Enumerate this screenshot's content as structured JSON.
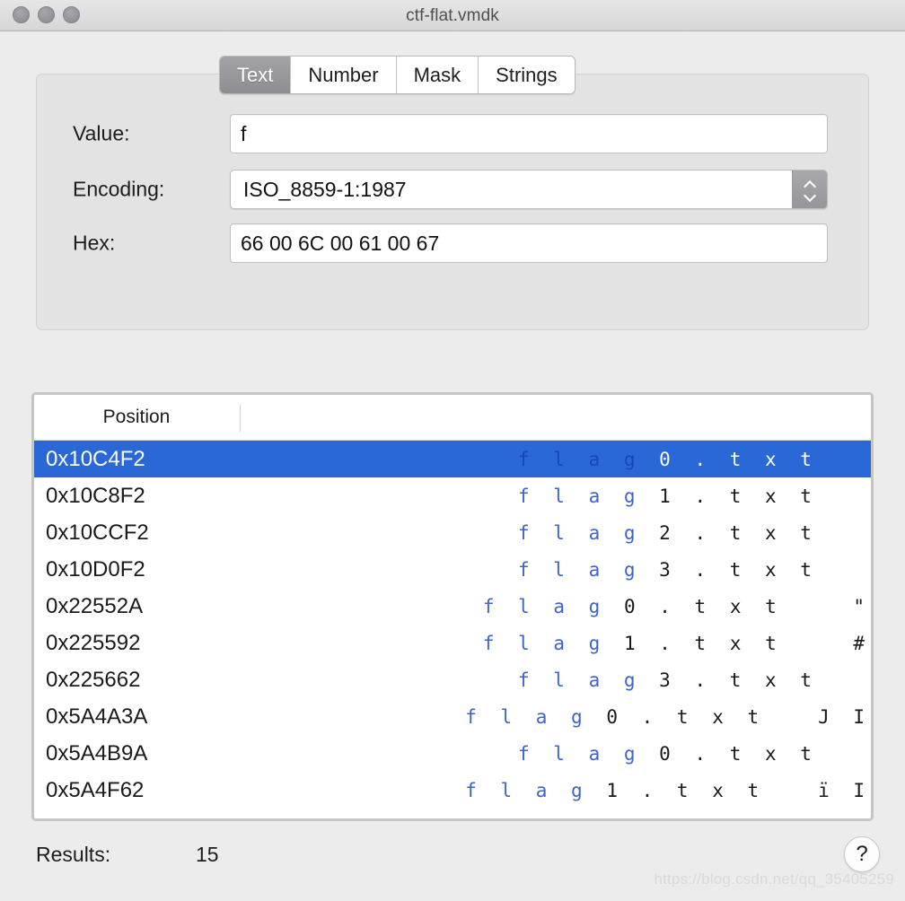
{
  "window": {
    "title": "ctf-flat.vmdk",
    "traffic_lights": [
      "close",
      "minimize",
      "zoom"
    ]
  },
  "tabs": [
    {
      "label": "Text",
      "selected": true
    },
    {
      "label": "Number",
      "selected": false
    },
    {
      "label": "Mask",
      "selected": false
    },
    {
      "label": "Strings",
      "selected": false
    }
  ],
  "form": {
    "value": {
      "label": "Value:",
      "text": "f",
      "placeholder": ""
    },
    "encoding": {
      "label": "Encoding:",
      "text": "ISO_8859-1:1987",
      "stepper_icon": "stepper-up-down-icon"
    },
    "hex": {
      "label": "Hex:",
      "text": "66 00 6C 00 61 00 67",
      "placeholder": ""
    }
  },
  "table": {
    "columns": [
      "Position",
      ""
    ],
    "rows": [
      {
        "position": "0x10C4F2",
        "match": "f l a g ",
        "rest": "0 . t x t",
        "trail": "",
        "selected": true
      },
      {
        "position": "0x10C8F2",
        "match": "f l a g ",
        "rest": "1 . t x t",
        "trail": "",
        "selected": false
      },
      {
        "position": "0x10CCF2",
        "match": "f l a g ",
        "rest": "2 . t x t",
        "trail": "",
        "selected": false
      },
      {
        "position": "0x10D0F2",
        "match": "f l a g ",
        "rest": "3 . t x t",
        "trail": "",
        "selected": false
      },
      {
        "position": "0x22552A",
        "match": "f l a g ",
        "rest": "0 . t x t",
        "trail": "    \"",
        "selected": false
      },
      {
        "position": "0x225592",
        "match": "f l a g ",
        "rest": "1 . t x t",
        "trail": "    #",
        "selected": false
      },
      {
        "position": "0x225662",
        "match": "f l a g ",
        "rest": "3 . t x t",
        "trail": "",
        "selected": false
      },
      {
        "position": "0x5A4A3A",
        "match": "f l a g ",
        "rest": "0 . t x t",
        "trail": "   J I",
        "selected": false
      },
      {
        "position": "0x5A4B9A",
        "match": "f l a g ",
        "rest": "0 . t x t",
        "trail": "",
        "selected": false
      },
      {
        "position": "0x5A4F62",
        "match": "f l a g ",
        "rest": "1 . t x t",
        "trail": "   ï I",
        "selected": false
      }
    ]
  },
  "footer": {
    "results_label": "Results:",
    "results_count": "15",
    "help_label": "?"
  },
  "watermark": "https://blog.csdn.net/qq_35405259",
  "colors": {
    "selection_blue": "#2a68d8",
    "match_blue": "#3c63cf",
    "window_chrome": "#ececec",
    "group_box": "#e3e3e3",
    "tab_selected": "#96969a"
  }
}
